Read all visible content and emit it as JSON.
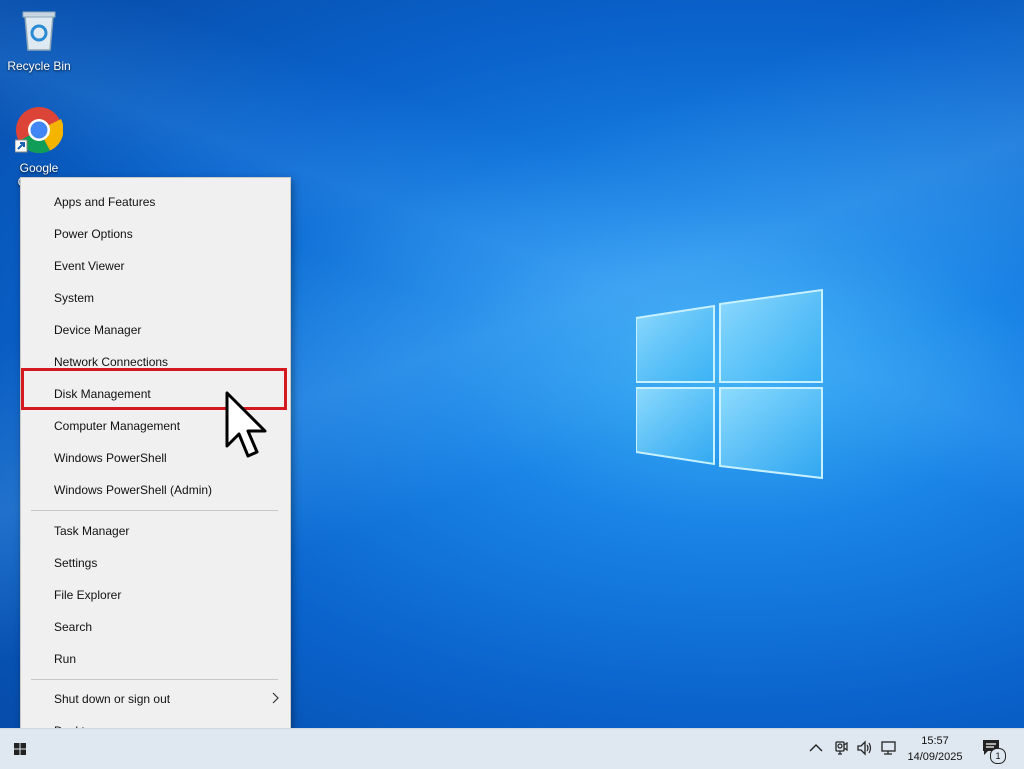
{
  "desktop": {
    "icons": [
      {
        "label": "Recycle Bin",
        "icon": "recycle-bin-icon"
      },
      {
        "label": "Google Chrome",
        "icon": "chrome-icon"
      }
    ]
  },
  "menu": {
    "group1": [
      {
        "label": "Apps and Features"
      },
      {
        "label": "Power Options"
      },
      {
        "label": "Event Viewer"
      },
      {
        "label": "System"
      },
      {
        "label": "Device Manager"
      },
      {
        "label": "Network Connections"
      },
      {
        "label": "Disk Management",
        "highlighted": true
      },
      {
        "label": "Computer Management"
      },
      {
        "label": "Windows PowerShell"
      },
      {
        "label": "Windows PowerShell (Admin)"
      }
    ],
    "group2": [
      {
        "label": "Task Manager"
      },
      {
        "label": "Settings"
      },
      {
        "label": "File Explorer"
      },
      {
        "label": "Search"
      },
      {
        "label": "Run"
      }
    ],
    "group3": [
      {
        "label": "Shut down or sign out",
        "has_submenu": true
      },
      {
        "label": "Desktop"
      }
    ],
    "highlight_color": "#d41920"
  },
  "taskbar": {
    "time": "15:57",
    "date": "14/09/2025",
    "notification_count": "1",
    "tray_icons": [
      "chevron-up-icon",
      "meet-now-icon",
      "volume-icon",
      "network-icon"
    ]
  }
}
